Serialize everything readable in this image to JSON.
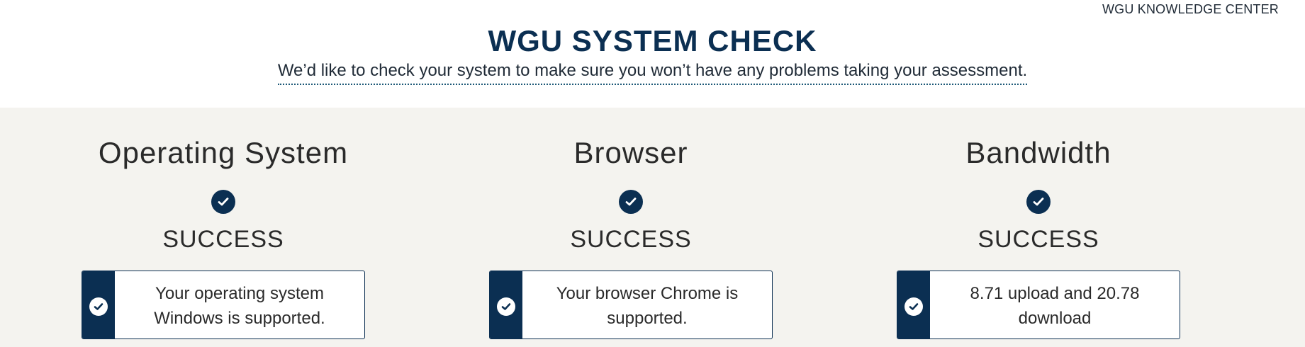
{
  "header": {
    "knowledge_center_link": "WGU KNOWLEDGE CENTER",
    "title": "WGU SYSTEM CHECK",
    "subtitle": "We’d like to check your system to make sure you won’t have any problems taking your assessment."
  },
  "checks": [
    {
      "title": "Operating System",
      "status": "SUCCESS",
      "message": "Your operating system Windows is supported.",
      "icon": "check-circle-icon"
    },
    {
      "title": "Browser",
      "status": "SUCCESS",
      "message": "Your browser Chrome is supported.",
      "icon": "check-circle-icon"
    },
    {
      "title": "Bandwidth",
      "status": "SUCCESS",
      "message": "8.71 upload and 20.78 download",
      "icon": "check-circle-icon"
    }
  ],
  "colors": {
    "brand_navy": "#0b2f52",
    "band_background": "#f4f3ef"
  }
}
